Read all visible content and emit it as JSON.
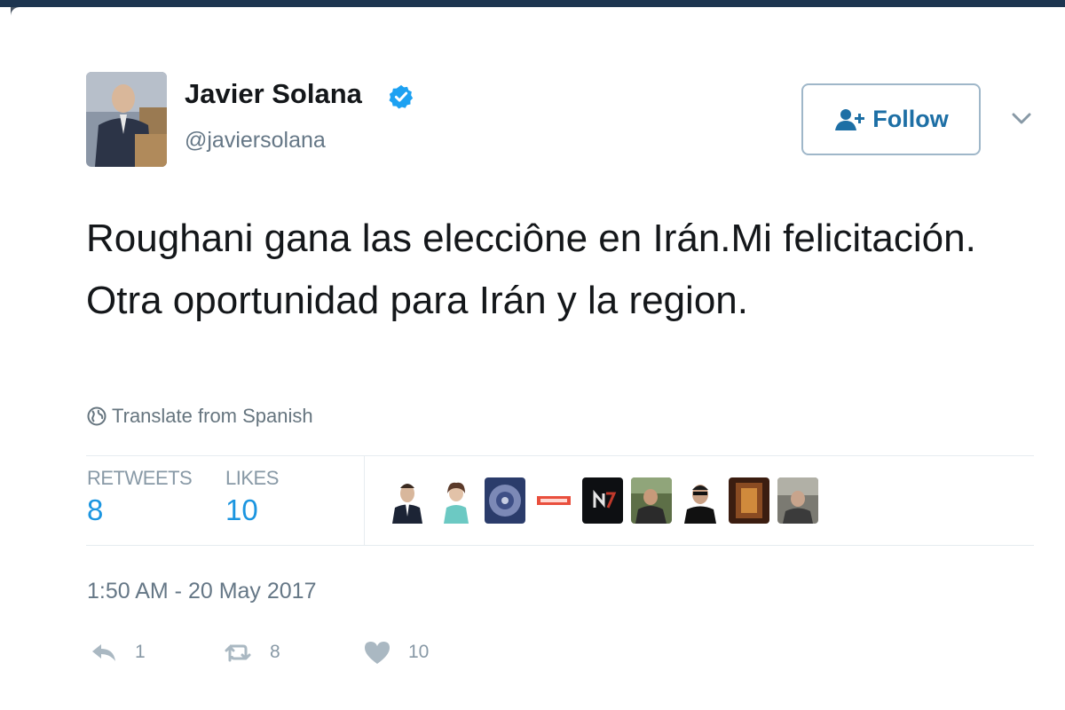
{
  "colors": {
    "brand": "#1da1f2",
    "link": "#1b95e0",
    "text": "#14171a",
    "secondary": "#657786"
  },
  "user": {
    "name": "Javier Solana",
    "handle": "@javiersolana",
    "verified_icon": "verified-badge-icon",
    "avatar_icon": "profile-photo"
  },
  "follow": {
    "label": "Follow",
    "icon": "add-user-icon"
  },
  "menu": {
    "icon": "chevron-down-icon"
  },
  "tweet": {
    "text": "Roughani gana las elecciône en Irán.Mi felicitación. Otra oportunidad para Irán y la region."
  },
  "translate": {
    "label": "Translate from Spanish",
    "icon": "globe-icon"
  },
  "stats": {
    "retweets_label": "RETWEETS",
    "retweets_count": "8",
    "likes_label": "LIKES",
    "likes_count": "10"
  },
  "timestamp": "1:50 AM - 20 May 2017",
  "actions": {
    "reply_count": "1",
    "retweet_count": "8",
    "like_count": "10"
  }
}
